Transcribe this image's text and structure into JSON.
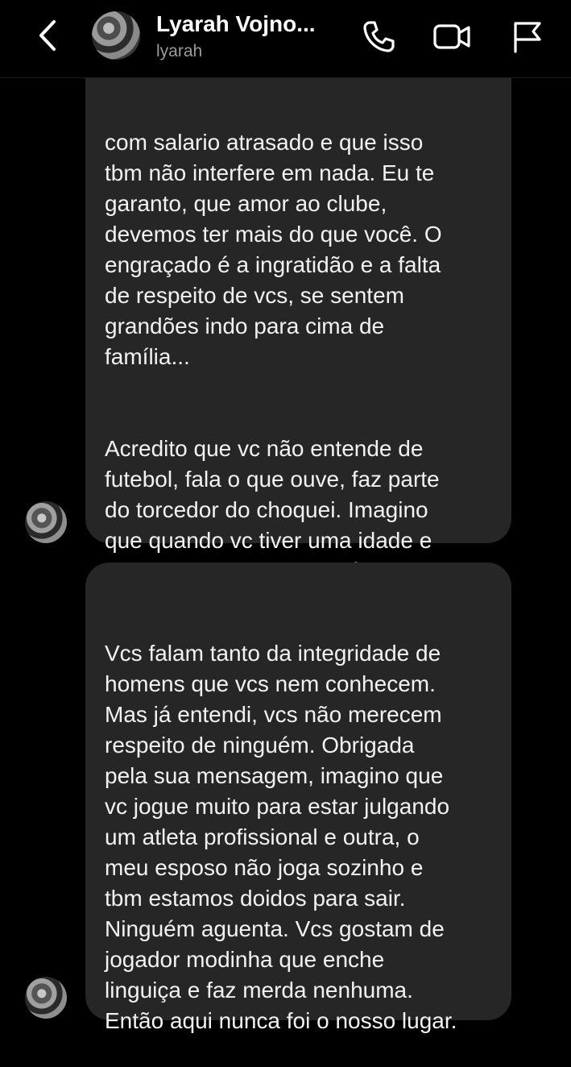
{
  "header": {
    "contact_name": "Lyarah Vojno...",
    "username": "lyarah",
    "icons": [
      "chevron-left-icon",
      "phone-icon",
      "video-camera-icon",
      "flag-icon"
    ]
  },
  "messages": [
    {
      "lines_part1": "com salario atrasado e que isso\ntbm não interfere em nada. Eu te\ngaranto, que amor ao clube,\ndevemos ter mais do que você. O\nengraçado é a ingratidão e a falta\nde respeito de vcs, se sentem\ngrandões indo para cima de\nfamília...",
      "lines_part2": "Acredito que vc não entende de\nfutebol, fala o que ouve, faz parte\ndo torcedor do choquei. Imagino\nque quando vc tiver uma idade e\ncomeçar a trabalhar, será daquele\ntipo que vai ao postinho pegar\natestado pq tá gripadinho."
    },
    {
      "text": "Vcs falam tanto da integridade de\nhomens que vcs nem conhecem.\nMas já entendi, vcs não merecem\nrespeito de ninguém. Obrigada\npela sua mensagem, imagino que\nvc jogue muito para estar julgando\num atleta profissional e outra, o\nmeu esposo não joga sozinho e\ntbm estamos doidos para sair.\nNinguém aguenta. Vcs gostam de\njogador modinha que enche\nlinguiça e faz merda nenhuma.\nEntão aqui nunca foi o nosso lugar."
    }
  ],
  "colors": {
    "background": "#000000",
    "bubble": "#262626",
    "text": "#f2f2f2",
    "muted": "#9a9a9a"
  }
}
